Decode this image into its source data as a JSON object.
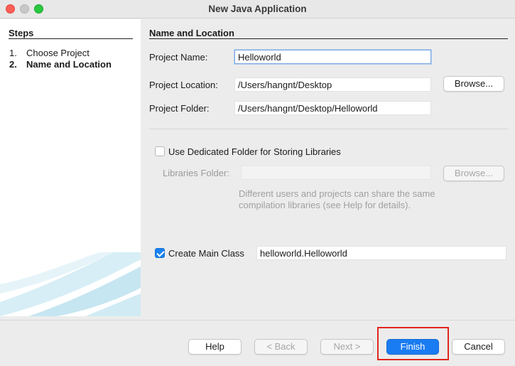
{
  "window": {
    "title": "New Java Application"
  },
  "steps": {
    "title": "Steps",
    "items": [
      {
        "num": "1.",
        "label": "Choose Project"
      },
      {
        "num": "2.",
        "label": "Name and Location"
      }
    ]
  },
  "section": {
    "title": "Name and Location"
  },
  "form": {
    "project_name_label": "Project Name:",
    "project_name_value": "Helloworld",
    "project_location_label": "Project Location:",
    "project_location_value": "/Users/hangnt/Desktop",
    "project_folder_label": "Project Folder:",
    "project_folder_value": "/Users/hangnt/Desktop/Helloworld",
    "browse_label": "Browse...",
    "dedicated_folder_label": "Use Dedicated Folder for Storing Libraries",
    "dedicated_folder_checked": false,
    "libraries_folder_label": "Libraries Folder:",
    "libraries_folder_value": "",
    "libraries_browse_label": "Browse...",
    "hint": "Different users and projects can share the same compilation libraries (see Help for details).",
    "create_main_label": "Create Main Class",
    "create_main_checked": true,
    "main_class_value": "helloworld.Helloworld"
  },
  "buttons": {
    "help": "Help",
    "back": "< Back",
    "next": "Next >",
    "finish": "Finish",
    "cancel": "Cancel"
  },
  "colors": {
    "accent": "#1a7cf2",
    "highlight": "#e3261b"
  }
}
